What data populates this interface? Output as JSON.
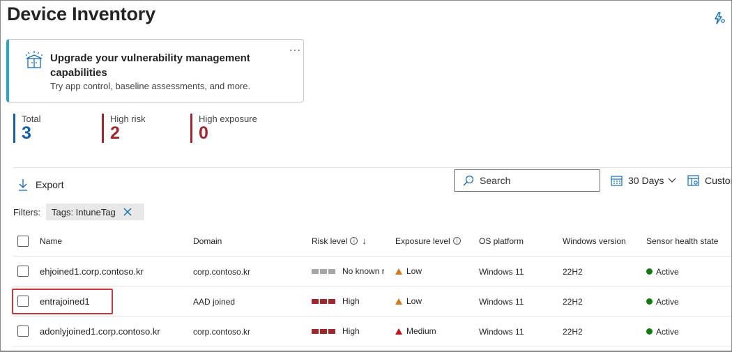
{
  "page": {
    "title": "Device Inventory",
    "top_right_icon": "settings-flash-icon"
  },
  "promo": {
    "icon": "gift-box-icon",
    "title": "Upgrade your vulnerability management capabilities",
    "subtitle": "Try app control, baseline assessments, and more.",
    "more": "···"
  },
  "stats": [
    {
      "label": "Total",
      "value": "3",
      "color": "#1660a7"
    },
    {
      "label": "High risk",
      "value": "2",
      "color": "#a4262c"
    },
    {
      "label": "High exposure",
      "value": "0",
      "color": "#a4262c"
    }
  ],
  "toolbar": {
    "export_label": "Export",
    "search_placeholder": "Search",
    "days_label": "30 Days",
    "custom_label": "Custom"
  },
  "filters": {
    "label": "Filters:",
    "chips": [
      "Tags: IntuneTag"
    ]
  },
  "table": {
    "columns": [
      "Name",
      "Domain",
      "Risk level",
      "Exposure level",
      "OS platform",
      "Windows version",
      "Sensor health state"
    ],
    "rows": [
      {
        "name": "ehjoined1.corp.contoso.kr",
        "domain": "corp.contoso.kr",
        "risk": "No known ri",
        "risk_level": 0,
        "exposure": "Low",
        "exposure_color": "#d9741a",
        "os": "Windows 11",
        "version": "22H2",
        "sensor": "Active"
      },
      {
        "name": "entrajoined1",
        "domain": "AAD joined",
        "risk": "High",
        "risk_level": 3,
        "exposure": "Low",
        "exposure_color": "#d9741a",
        "os": "Windows 11",
        "version": "22H2",
        "sensor": "Active"
      },
      {
        "name": "adonlyjoined1.corp.contoso.kr",
        "domain": "corp.contoso.kr",
        "risk": "High",
        "risk_level": 3,
        "exposure": "Medium",
        "exposure_color": "#c50f1f",
        "os": "Windows 11",
        "version": "22H2",
        "sensor": "Active"
      }
    ]
  },
  "colors": {
    "risk_high": "#a4262c",
    "risk_none": "#a6a6a6",
    "sensor_active": "#107c10",
    "promo_accent": "#2ba3c7"
  }
}
